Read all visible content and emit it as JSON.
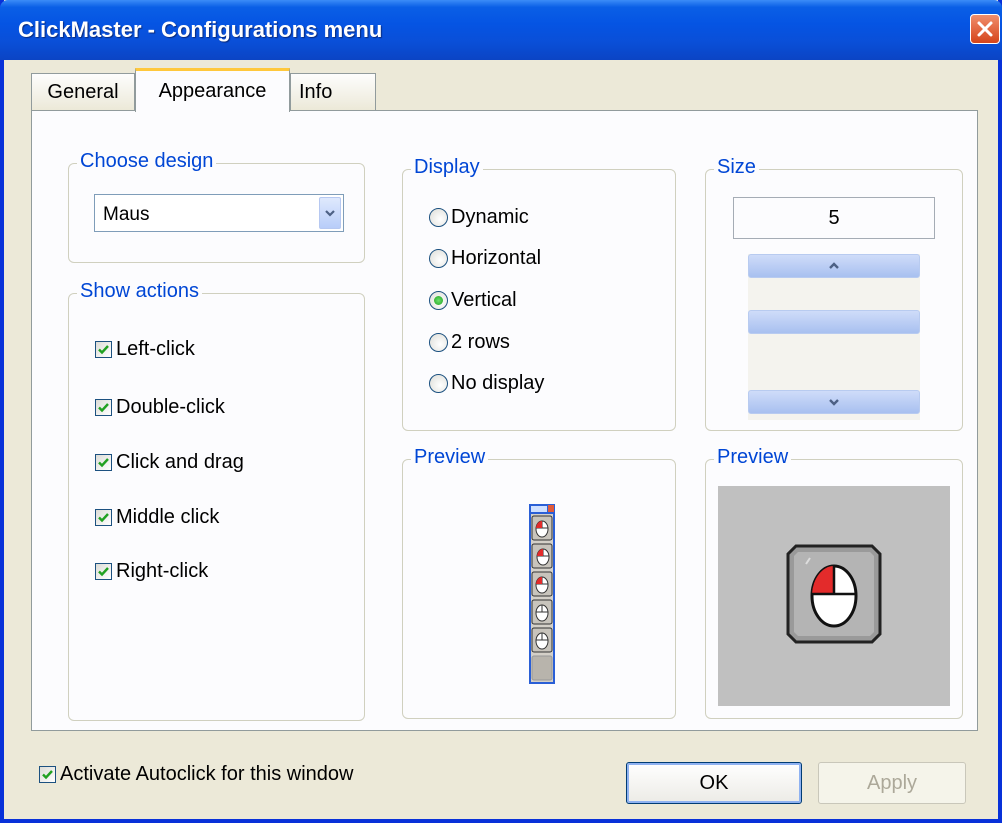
{
  "window": {
    "title": "ClickMaster - Configurations menu"
  },
  "tabs": [
    {
      "label": "General",
      "active": false
    },
    {
      "label": "Appearance",
      "active": true
    },
    {
      "label": "Info",
      "active": false
    }
  ],
  "choose_design": {
    "label": "Choose design",
    "selected": "Maus"
  },
  "show_actions": {
    "label": "Show actions",
    "items": [
      {
        "label": "Left-click",
        "checked": true
      },
      {
        "label": "Double-click",
        "checked": true
      },
      {
        "label": "Click and drag",
        "checked": true
      },
      {
        "label": "Middle click",
        "checked": true
      },
      {
        "label": "Right-click",
        "checked": true
      }
    ]
  },
  "display": {
    "label": "Display",
    "options": [
      {
        "label": "Dynamic",
        "selected": false
      },
      {
        "label": "Horizontal",
        "selected": false
      },
      {
        "label": "Vertical",
        "selected": true
      },
      {
        "label": "2 rows",
        "selected": false
      },
      {
        "label": "No display",
        "selected": false
      }
    ]
  },
  "size": {
    "label": "Size",
    "value": "5"
  },
  "preview_toolbar": {
    "label": "Preview"
  },
  "preview_icon": {
    "label": "Preview"
  },
  "footer": {
    "autoclick_label": "Activate Autoclick for this window",
    "autoclick_checked": true,
    "ok_label": "OK",
    "apply_label": "Apply"
  },
  "colors": {
    "title_bar": "#0554e3",
    "group_label": "#0046d5",
    "dialog_bg": "#ece9d8"
  }
}
